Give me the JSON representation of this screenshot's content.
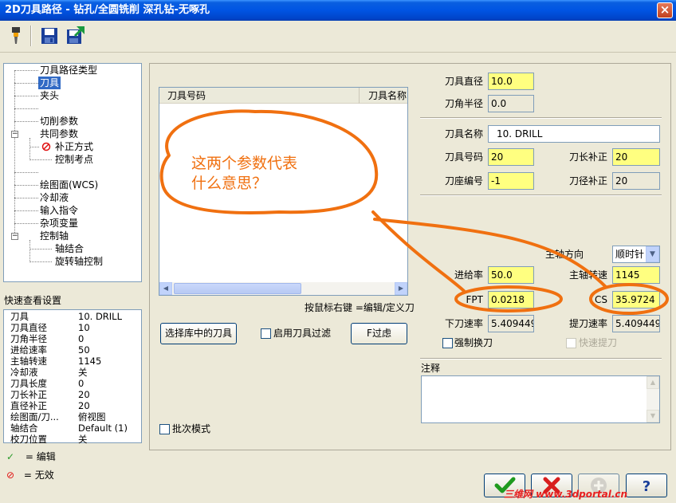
{
  "window": {
    "title": "2D刀具路径 - 钻孔/全圆铣削 深孔钻-无啄孔",
    "close_label": "×"
  },
  "toolbar": {
    "icons": [
      "tool-icon",
      "save-icon",
      "save-as-icon"
    ]
  },
  "tree": {
    "items": [
      {
        "label": "刀具路径类型"
      },
      {
        "label": "刀具"
      },
      {
        "label": "夹头"
      },
      {
        "label": "切削参数"
      },
      {
        "label": "共同参数"
      },
      {
        "label": "补正方式"
      },
      {
        "label": "控制考点"
      },
      {
        "label": "绘图面(WCS)"
      },
      {
        "label": "冷却液"
      },
      {
        "label": "输入指令"
      },
      {
        "label": "杂项变量"
      },
      {
        "label": "控制轴"
      },
      {
        "label": "轴结合"
      },
      {
        "label": "旋转轴控制"
      }
    ]
  },
  "quick_view": {
    "title": "快速查看设置",
    "rows": [
      {
        "key": "刀具",
        "value": "10. DRILL"
      },
      {
        "key": "刀具直径",
        "value": "10"
      },
      {
        "key": "刀角半径",
        "value": "0"
      },
      {
        "key": "进给速率",
        "value": "50"
      },
      {
        "key": "主轴转速",
        "value": "1145"
      },
      {
        "key": "冷却液",
        "value": "关"
      },
      {
        "key": "刀具长度",
        "value": "0"
      },
      {
        "key": "刀长补正",
        "value": "20"
      },
      {
        "key": "直径补正",
        "value": "20"
      },
      {
        "key": "绘图面/刀...",
        "value": "俯视图"
      },
      {
        "key": "轴结合",
        "value": "Default (1)"
      },
      {
        "key": "校刀位置",
        "value": "关"
      }
    ]
  },
  "legend": {
    "edit": "= 编辑",
    "invalid": "= 无效"
  },
  "tool_list": {
    "col1": "刀具号码",
    "col2": "刀具名称"
  },
  "hint": "按鼠标右键 =编辑/定义刀",
  "buttons": {
    "select_library": "选择库中的刀具",
    "filter": "F过虑"
  },
  "checkboxes": {
    "enable_filter": "启用刀具过滤",
    "batch_mode": "批次模式",
    "force_change": "强制换刀",
    "rapid_retract": "快速提刀"
  },
  "params": {
    "tool_dia_label": "刀具直径",
    "tool_dia": "10.0",
    "corner_rad_label": "刀角半径",
    "corner_rad": "0.0",
    "tool_name_label": "刀具名称",
    "tool_name": "10. DRILL",
    "tool_num_label": "刀具号码",
    "tool_num": "20",
    "len_comp_label": "刀长补正",
    "len_comp": "20",
    "holder_num_label": "刀座编号",
    "holder_num": "-1",
    "dia_comp_label": "刀径补正",
    "dia_comp": "20",
    "spindle_dir_label": "主轴方向",
    "spindle_dir": "顺时针",
    "feed_label": "进给率",
    "feed": "50.0",
    "spindle_speed_label": "主轴转速",
    "spindle_speed": "1145",
    "fpt_label": "FPT",
    "fpt": "0.0218",
    "cs_label": "CS",
    "cs": "35.9724",
    "plunge_label": "下刀速率",
    "plunge": "5.409449",
    "retract_label": "提刀速率",
    "retract": "5.409449",
    "notes_label": "注释"
  },
  "annotation": {
    "line1": "这两个参数代表",
    "line2": "什么意思？",
    "color": "#f07010"
  },
  "watermark": "三维网 www.3dportal.cn"
}
